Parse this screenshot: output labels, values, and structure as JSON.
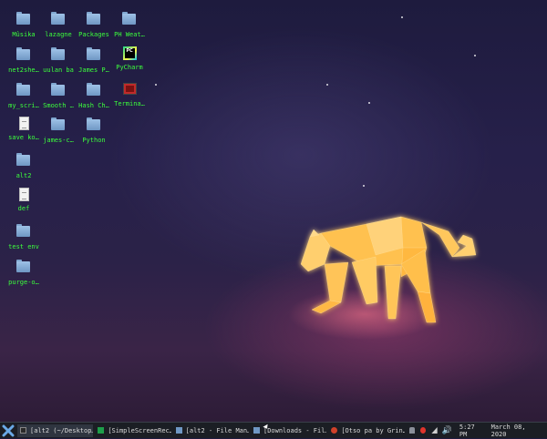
{
  "desktop": {
    "icons": [
      {
        "label": "Mûsika",
        "type": "folder"
      },
      {
        "label": "lazagne",
        "type": "folder"
      },
      {
        "label": "Packages",
        "type": "folder"
      },
      {
        "label": "PH Weat…",
        "type": "folder"
      },
      {
        "label": "net2she…",
        "type": "folder"
      },
      {
        "label": "uulan ba",
        "type": "folder"
      },
      {
        "label": "James P…",
        "type": "folder"
      },
      {
        "label": "PyCharm",
        "type": "pycharm"
      },
      {
        "label": "my_scri…",
        "type": "folder"
      },
      {
        "label": "Smooth …",
        "type": "folder"
      },
      {
        "label": "Hash Ch…",
        "type": "folder"
      },
      {
        "label": "Termina…",
        "type": "terminal"
      },
      {
        "label": "save ko…",
        "type": "document"
      },
      {
        "label": "james-c…",
        "type": "folder"
      },
      {
        "label": "Python",
        "type": "folder"
      },
      {
        "label": "alt2",
        "type": "folder"
      },
      {
        "label": "def",
        "type": "document"
      },
      {
        "label": "test env",
        "type": "folder"
      },
      {
        "label": "purge-o…",
        "type": "folder"
      }
    ]
  },
  "taskbar": {
    "tasks": [
      {
        "label": "[alt2 (~/Desktop…",
        "icon": "terminal-icon",
        "active": true
      },
      {
        "label": "[SimpleScreenRec…",
        "icon": "recorder-icon",
        "active": false
      },
      {
        "label": "[alt2 - File Man…",
        "icon": "folder-icon",
        "active": false
      },
      {
        "label": "[Downloads - Fil…",
        "icon": "folder-icon",
        "active": false
      },
      {
        "label": "[Otso pa by Grin…",
        "icon": "browser-icon",
        "active": false
      }
    ],
    "clock": "5:27 PM",
    "date": "March 08, 2020"
  },
  "colors": {
    "icon_label": "#3cff3c",
    "taskbar_bg": "#1b1e24",
    "cat": "#ffc45a"
  }
}
